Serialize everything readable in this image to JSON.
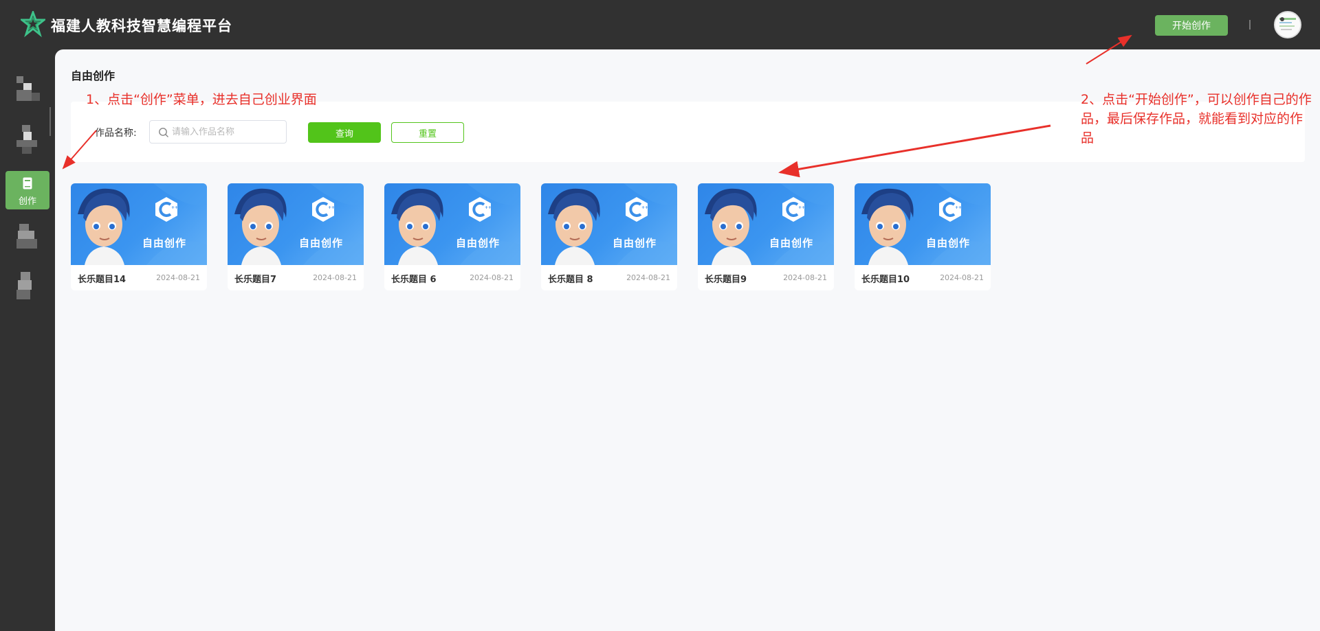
{
  "header": {
    "app_title": "福建人教科技智慧编程平台",
    "start_button": "开始创作"
  },
  "sidebar": {
    "active_item_label": "创作"
  },
  "main": {
    "page_title": "自由创作",
    "search": {
      "label": "作品名称:",
      "placeholder": "请输入作品名称",
      "value": ""
    },
    "query_button": "查询",
    "reset_button": "重置",
    "card_thumb_text": "自由创作",
    "cards": [
      {
        "name": "长乐题目14",
        "date": "2024-08-21"
      },
      {
        "name": "长乐题目7",
        "date": "2024-08-21"
      },
      {
        "name": "长乐题目 6",
        "date": "2024-08-21"
      },
      {
        "name": "长乐题目 8",
        "date": "2024-08-21"
      },
      {
        "name": "长乐题目9",
        "date": "2024-08-21"
      },
      {
        "name": "长乐题目10",
        "date": "2024-08-21"
      }
    ]
  },
  "annotations": {
    "note1": "1、点击“创作”菜单，进去自己创业界面",
    "note2": "2、点击“开始创作”，可以创作自己的作品，最后保存作品，就能看到对应的作品"
  },
  "colors": {
    "header_bg": "#313131",
    "accent_green": "#6bb35f",
    "query_green": "#52c41a",
    "annotation_red": "#e8302a",
    "card_blue": "#2f86e8"
  },
  "icons": {
    "logo": "green-star-logo-icon",
    "sidebar_create": "document-icon",
    "search": "search-icon",
    "card_badge": "cpp-icon"
  }
}
